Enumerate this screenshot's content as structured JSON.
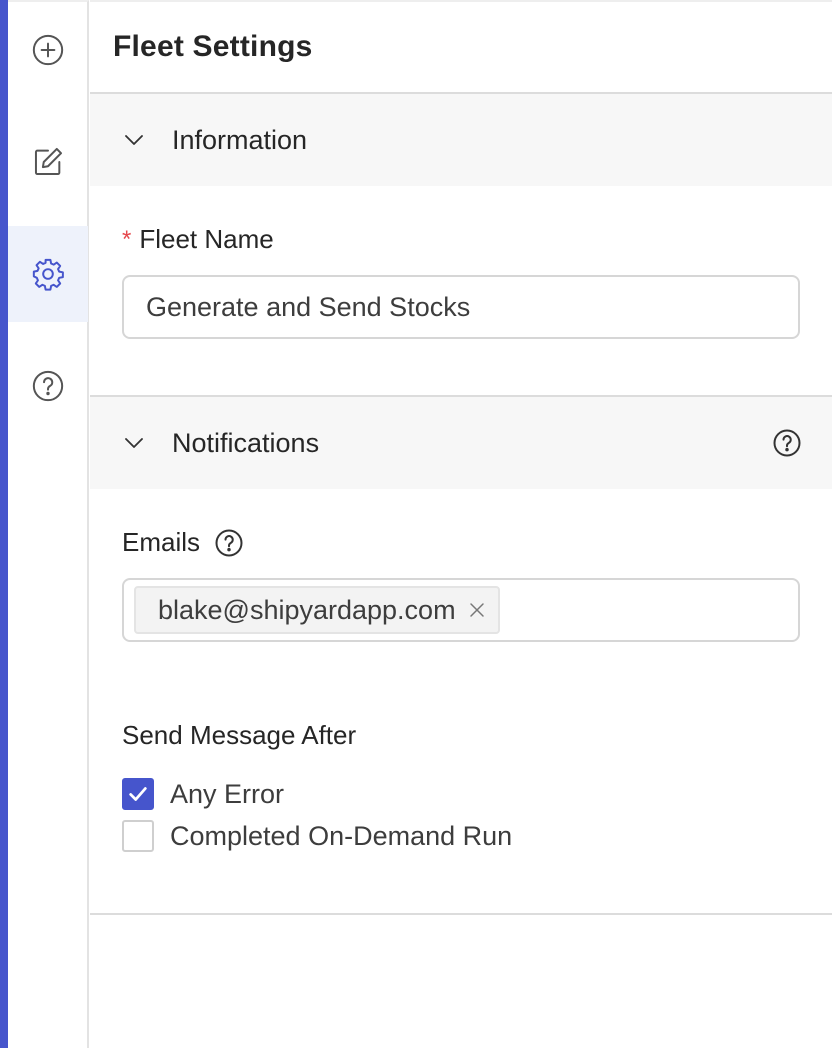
{
  "rail": {
    "items": [
      {
        "icon": "add-circle-icon"
      },
      {
        "icon": "edit-icon"
      },
      {
        "icon": "gear-icon",
        "active": true
      },
      {
        "icon": "help-circle-icon"
      }
    ]
  },
  "header": {
    "title": "Fleet Settings"
  },
  "information": {
    "heading": "Information",
    "fleet_name": {
      "required_mark": "*",
      "label": "Fleet Name",
      "value": "Generate and Send Stocks"
    }
  },
  "notifications": {
    "heading": "Notifications",
    "emails": {
      "label": "Emails",
      "tags": [
        "blake@shipyardapp.com"
      ]
    },
    "send_after": {
      "label": "Send Message After",
      "options": [
        {
          "label": "Any Error",
          "checked": true
        },
        {
          "label": "Completed On-Demand Run",
          "checked": false
        }
      ]
    }
  },
  "colors": {
    "accent": "#4655cc",
    "active_rail_bg": "#eef2fb",
    "required": "#e5484d"
  }
}
